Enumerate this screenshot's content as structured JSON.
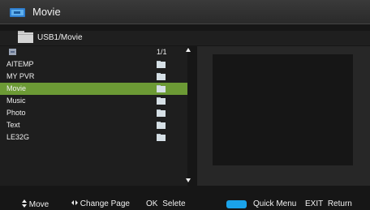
{
  "window": {
    "title": "Movie",
    "title_icon": "media-screen-icon"
  },
  "path": {
    "label": "USB1/Movie",
    "icon": "folder-icon"
  },
  "list": {
    "header_icon": "folder-up-icon",
    "page_indicator": "1/1",
    "items": [
      {
        "label": "AITEMP",
        "icon": "folder-icon"
      },
      {
        "label": "MY PVR",
        "icon": "folder-icon"
      },
      {
        "label": "Movie",
        "icon": "folder-icon",
        "selected": true
      },
      {
        "label": "Music",
        "icon": "folder-icon"
      },
      {
        "label": "Photo",
        "icon": "folder-icon"
      },
      {
        "label": "Text",
        "icon": "folder-icon"
      },
      {
        "label": "LE32G",
        "icon": "folder-icon"
      }
    ],
    "selected_color": "#6c9a35"
  },
  "footer": {
    "move": "Move",
    "change_page": "Change Page",
    "ok_key": "OK",
    "ok_action": "Selete",
    "quick_menu": "Quick Menu",
    "exit_key": "EXIT",
    "exit_action": "Return",
    "quick_menu_color": "#1aa3ea"
  }
}
